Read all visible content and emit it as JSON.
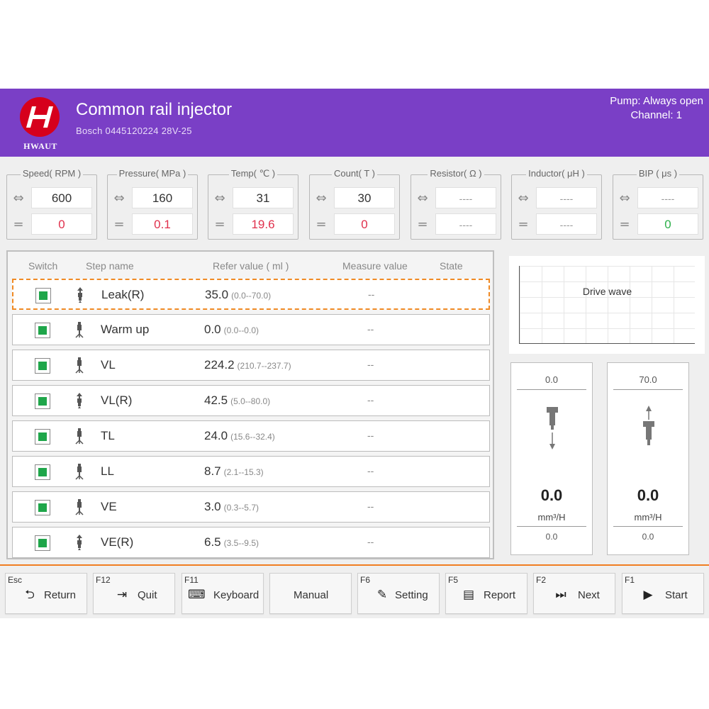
{
  "header": {
    "brand": "HWAUT",
    "title": "Common rail injector",
    "subtitle": "Bosch  0445120224  28V-25",
    "pump": "Pump: Always open",
    "channel": "Channel: 1",
    "color": "#7a3fc6"
  },
  "gauges": [
    {
      "title": "Speed( RPM )",
      "set": "600",
      "actual": "0"
    },
    {
      "title": "Pressure( MPa )",
      "set": "160",
      "actual": "0.1"
    },
    {
      "title": "Temp( ℃ )",
      "set": "31",
      "actual": "19.6"
    },
    {
      "title": "Count( T )",
      "set": "30",
      "actual": "0"
    },
    {
      "title": "Resistor( Ω )",
      "set": "----",
      "actual": "----"
    },
    {
      "title": "Inductor( μH )",
      "set": "----",
      "actual": "----"
    },
    {
      "title": "BIP ( μs )",
      "set": "----",
      "actual": "0"
    }
  ],
  "table": {
    "headers": {
      "switch": "Switch",
      "step": "Step name",
      "refer": "Refer value ( ml )",
      "measure": "Measure value",
      "state": "State"
    },
    "rows": [
      {
        "name": "Leak(R)",
        "value": "35.0",
        "range": "(0.0--70.0)",
        "measure": "--",
        "icon": "injector-up-icon"
      },
      {
        "name": "Warm up",
        "value": "0.0",
        "range": "(0.0--0.0)",
        "measure": "--",
        "icon": "injector-spray-icon"
      },
      {
        "name": "VL",
        "value": "224.2",
        "range": "(210.7--237.7)",
        "measure": "--",
        "icon": "injector-spray-icon"
      },
      {
        "name": "VL(R)",
        "value": "42.5",
        "range": "(5.0--80.0)",
        "measure": "--",
        "icon": "injector-up-icon"
      },
      {
        "name": "TL",
        "value": "24.0",
        "range": "(15.6--32.4)",
        "measure": "--",
        "icon": "injector-spray-icon"
      },
      {
        "name": "LL",
        "value": "8.7",
        "range": "(2.1--15.3)",
        "measure": "--",
        "icon": "injector-spray-icon"
      },
      {
        "name": "VE",
        "value": "3.0",
        "range": "(0.3--5.7)",
        "measure": "--",
        "icon": "injector-spray-icon"
      },
      {
        "name": "VE(R)",
        "value": "6.5",
        "range": "(3.5--9.5)",
        "measure": "--",
        "icon": "injector-up-icon"
      }
    ]
  },
  "wave": {
    "label": "Drive wave"
  },
  "meters": [
    {
      "top": "0.0",
      "big": "0.0",
      "unit": "mm³/H",
      "bottom": "0.0",
      "icon": "injector-down-arrow-icon"
    },
    {
      "top": "70.0",
      "big": "0.0",
      "unit": "mm³/H",
      "bottom": "0.0",
      "icon": "injector-up-arrow-icon"
    }
  ],
  "footer": [
    {
      "key": "Esc",
      "label": "Return",
      "icon": "return-icon",
      "glyph": "⮌"
    },
    {
      "key": "F12",
      "label": "Quit",
      "icon": "quit-icon",
      "glyph": "⇥"
    },
    {
      "key": "F11",
      "label": "Keyboard",
      "icon": "keyboard-icon",
      "glyph": "⌨"
    },
    {
      "key": "",
      "label": "Manual",
      "icon": "",
      "glyph": ""
    },
    {
      "key": "F6",
      "label": "Setting",
      "icon": "edit-icon",
      "glyph": "✎"
    },
    {
      "key": "F5",
      "label": "Report",
      "icon": "report-icon",
      "glyph": "▤"
    },
    {
      "key": "F2",
      "label": "Next",
      "icon": "next-icon",
      "glyph": "⏭"
    },
    {
      "key": "F1",
      "label": "Start",
      "icon": "play-icon",
      "glyph": "▶"
    }
  ]
}
